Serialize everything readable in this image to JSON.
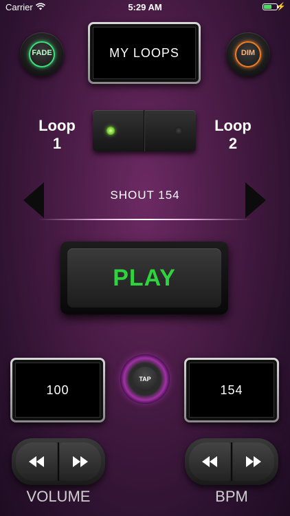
{
  "status_bar": {
    "carrier": "Carrier",
    "time": "5:29 AM",
    "battery_level": 0.6,
    "charging_glyph": "⚡"
  },
  "top_controls": {
    "fade_label": "FADE",
    "title_label": "MY LOOPS",
    "dim_label": "DIM"
  },
  "loop_switch": {
    "left_label_line1": "Loop",
    "left_label_line2": "1",
    "right_label_line1": "Loop",
    "right_label_line2": "2",
    "active": "Loop 1"
  },
  "track": {
    "name": "SHOUT 154"
  },
  "play_button": {
    "label": "PLAY"
  },
  "volume_display": {
    "value": "100"
  },
  "tap_button": {
    "label": "TAP"
  },
  "bpm_display": {
    "value": "154"
  },
  "volume_control": {
    "label": "VOLUME"
  },
  "bpm_control": {
    "label": "BPM"
  },
  "colors": {
    "fade_accent": "#3fe07a",
    "dim_accent": "#f07b2a",
    "play_text": "#2fd33f",
    "tap_ring": "#a230a6",
    "background": "#4a1c46"
  },
  "icons": [
    "wifi-icon",
    "battery-icon",
    "prev-track-icon",
    "next-track-icon",
    "rewind-icon",
    "fast-forward-icon"
  ]
}
